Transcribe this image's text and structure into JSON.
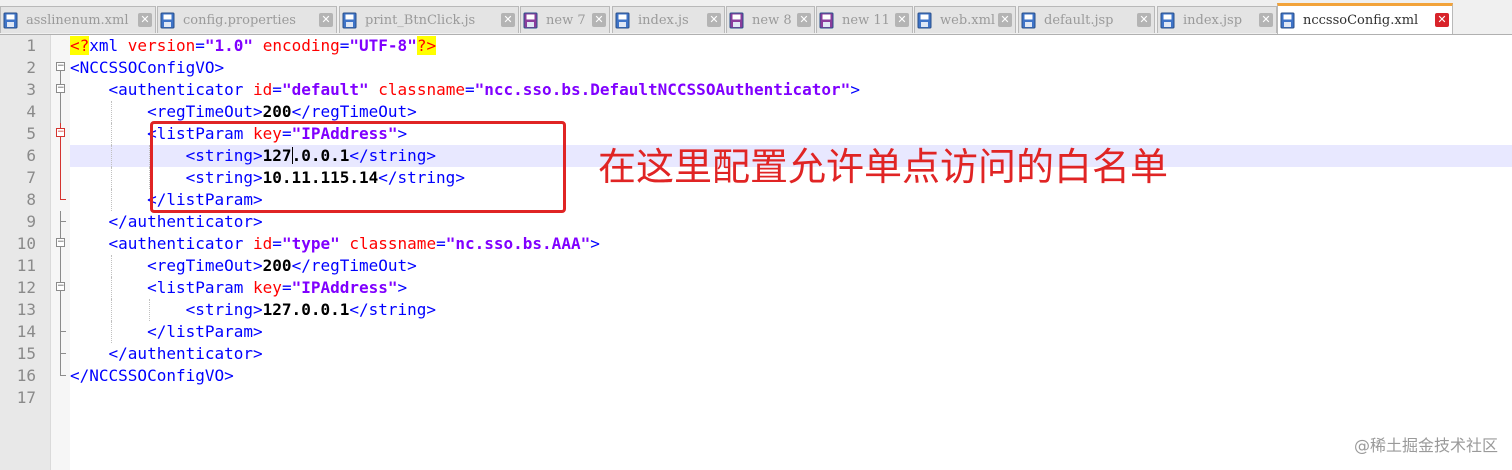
{
  "tabs": [
    {
      "label": "asslinenum.xml",
      "icon": "saved-file-icon",
      "active": false
    },
    {
      "label": "config.properties",
      "icon": "saved-file-icon",
      "active": false
    },
    {
      "label": "print_BtnClick.js",
      "icon": "saved-file-icon",
      "active": false
    },
    {
      "label": "new 7",
      "icon": "unsaved-file-icon",
      "active": false
    },
    {
      "label": "index.js",
      "icon": "saved-file-icon",
      "active": false
    },
    {
      "label": "new 8",
      "icon": "unsaved-file-icon",
      "active": false
    },
    {
      "label": "new 11",
      "icon": "unsaved-file-icon",
      "active": false
    },
    {
      "label": "web.xml",
      "icon": "saved-file-icon",
      "active": false
    },
    {
      "label": "default.jsp",
      "icon": "saved-file-icon",
      "active": false
    },
    {
      "label": "index.jsp",
      "icon": "saved-file-icon",
      "active": false
    },
    {
      "label": "nccssoConfig.xml",
      "icon": "saved-file-icon",
      "active": true
    }
  ],
  "close_glyph": "✕",
  "editor": {
    "current_line": 6,
    "lines": [
      {
        "n": "1",
        "fold": "none",
        "indent": 0,
        "tokens": [
          [
            "decl",
            "<?"
          ],
          [
            "declname",
            "xml "
          ],
          [
            "attr",
            "version"
          ],
          [
            "tag",
            "="
          ],
          [
            "val",
            "\"1.0\""
          ],
          [
            "tag",
            " "
          ],
          [
            "attr",
            "encoding"
          ],
          [
            "tag",
            "="
          ],
          [
            "val",
            "\"UTF-8\""
          ],
          [
            "decl",
            "?>"
          ]
        ]
      },
      {
        "n": "2",
        "fold": "open-top",
        "indent": 0,
        "tokens": [
          [
            "tag",
            "<NCCSSOConfigVO>"
          ]
        ]
      },
      {
        "n": "3",
        "fold": "open",
        "indent": 1,
        "tokens": [
          [
            "tag",
            "<authenticator "
          ],
          [
            "attr",
            "id"
          ],
          [
            "tag",
            "="
          ],
          [
            "val",
            "\"default\""
          ],
          [
            "tag",
            " "
          ],
          [
            "attr",
            "classname"
          ],
          [
            "tag",
            "="
          ],
          [
            "val",
            "\"ncc.sso.bs.DefaultNCCSSOAuthenticator\""
          ],
          [
            "tag",
            ">"
          ]
        ]
      },
      {
        "n": "4",
        "fold": "line",
        "indent": 2,
        "tokens": [
          [
            "tag",
            "<regTimeOut>"
          ],
          [
            "text",
            "200"
          ],
          [
            "tag",
            "</regTimeOut>"
          ]
        ]
      },
      {
        "n": "5",
        "fold": "open-red",
        "indent": 2,
        "tokens": [
          [
            "tag",
            "<listParam "
          ],
          [
            "attr",
            "key"
          ],
          [
            "tag",
            "="
          ],
          [
            "val",
            "\"IPAddress\""
          ],
          [
            "tag",
            ">"
          ]
        ]
      },
      {
        "n": "6",
        "fold": "line-red",
        "indent": 3,
        "tokens": [
          [
            "tag",
            "<string>"
          ],
          [
            "text",
            "127"
          ],
          [
            "caret",
            ""
          ],
          [
            "text",
            ".0.0.1"
          ],
          [
            "tag",
            "</string>"
          ]
        ]
      },
      {
        "n": "7",
        "fold": "line-red",
        "indent": 3,
        "tokens": [
          [
            "tag",
            "<string>"
          ],
          [
            "text",
            "10.11.115.14"
          ],
          [
            "tag",
            "</string>"
          ]
        ]
      },
      {
        "n": "8",
        "fold": "end-red",
        "indent": 2,
        "tokens": [
          [
            "tag",
            "</listParam>"
          ]
        ]
      },
      {
        "n": "9",
        "fold": "end",
        "indent": 1,
        "tokens": [
          [
            "tag",
            "</authenticator>"
          ]
        ]
      },
      {
        "n": "10",
        "fold": "open",
        "indent": 1,
        "tokens": [
          [
            "tag",
            "<authenticator "
          ],
          [
            "attr",
            "id"
          ],
          [
            "tag",
            "="
          ],
          [
            "val",
            "\"type\""
          ],
          [
            "tag",
            " "
          ],
          [
            "attr",
            "classname"
          ],
          [
            "tag",
            "="
          ],
          [
            "val",
            "\"nc.sso.bs.AAA\""
          ],
          [
            "tag",
            ">"
          ]
        ]
      },
      {
        "n": "11",
        "fold": "line",
        "indent": 2,
        "tokens": [
          [
            "tag",
            "<regTimeOut>"
          ],
          [
            "text",
            "200"
          ],
          [
            "tag",
            "</regTimeOut>"
          ]
        ]
      },
      {
        "n": "12",
        "fold": "open",
        "indent": 2,
        "tokens": [
          [
            "tag",
            "<listParam "
          ],
          [
            "attr",
            "key"
          ],
          [
            "tag",
            "="
          ],
          [
            "val",
            "\"IPAddress\""
          ],
          [
            "tag",
            ">"
          ]
        ]
      },
      {
        "n": "13",
        "fold": "line",
        "indent": 3,
        "tokens": [
          [
            "tag",
            "<string>"
          ],
          [
            "text",
            "127.0.0.1"
          ],
          [
            "tag",
            "</string>"
          ]
        ]
      },
      {
        "n": "14",
        "fold": "end",
        "indent": 2,
        "tokens": [
          [
            "tag",
            "</listParam>"
          ]
        ]
      },
      {
        "n": "15",
        "fold": "end",
        "indent": 1,
        "tokens": [
          [
            "tag",
            "</authenticator>"
          ]
        ]
      },
      {
        "n": "16",
        "fold": "end-last",
        "indent": 0,
        "tokens": [
          [
            "tag",
            "</NCCSSOConfigVO>"
          ]
        ]
      },
      {
        "n": "17",
        "fold": "none",
        "indent": 0,
        "tokens": []
      }
    ]
  },
  "annotation": {
    "text": "在这里配置允许单点访问的白名单",
    "color": "#e02424"
  },
  "watermark": "@稀土掘金技术社区",
  "colors": {
    "tag": "#0000ff",
    "attr": "#ff0000",
    "value": "#8000ff",
    "active_tab_accent": "#f2a33a"
  }
}
